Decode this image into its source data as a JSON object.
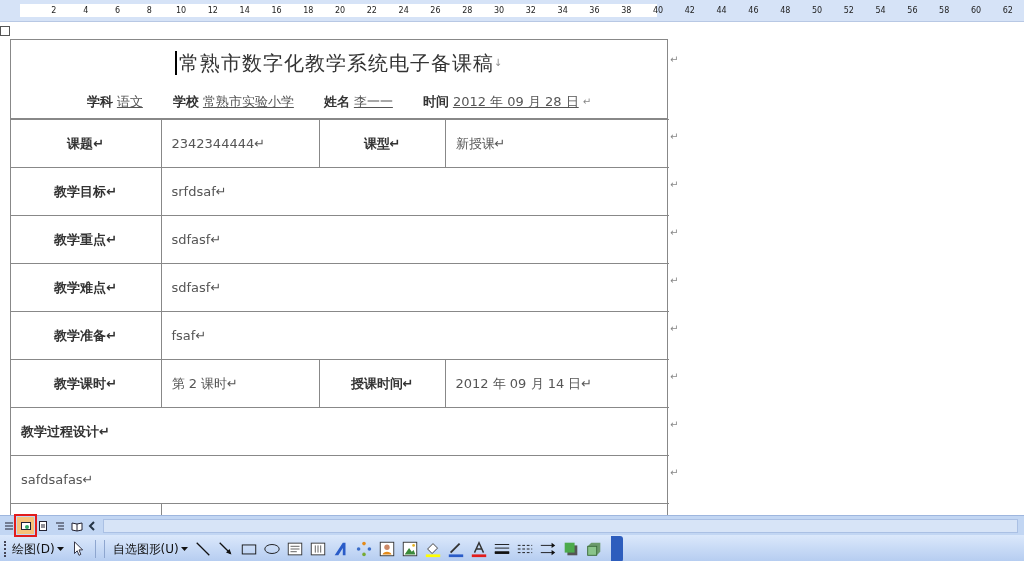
{
  "ruler": {
    "numbers": [
      "2",
      "4",
      "6",
      "8",
      "10",
      "12",
      "14",
      "16",
      "18",
      "20",
      "22",
      "24",
      "26",
      "28",
      "30",
      "32",
      "34",
      "36",
      "38",
      "40",
      "42",
      "44",
      "46",
      "48",
      "50",
      "52",
      "54",
      "56",
      "58",
      "60",
      "62"
    ]
  },
  "document": {
    "title": "常熟市数字化教学系统电子备课稿",
    "title_mark": "↓",
    "title_end_mark": "↵",
    "info": [
      {
        "label": "学科",
        "value": "语文"
      },
      {
        "label": "学校",
        "value": "常熟市实验小学"
      },
      {
        "label": "姓名",
        "value": "李一一"
      },
      {
        "label": "时间",
        "value": "2012 年 09 月 28 日"
      }
    ],
    "info_mark": "↵",
    "rows": [
      {
        "cells": [
          {
            "kind": "label",
            "text": "课题↵"
          },
          {
            "kind": "value",
            "text": "2342344444↵"
          },
          {
            "kind": "label",
            "text": "课型↵"
          },
          {
            "kind": "value",
            "text": "新授课↵"
          }
        ],
        "end_mark": "↵"
      },
      {
        "cells": [
          {
            "kind": "label",
            "text": "教学目标↵"
          },
          {
            "kind": "value",
            "text": "srfdsaf↵",
            "colspan": 3
          }
        ],
        "end_mark": "↵"
      },
      {
        "cells": [
          {
            "kind": "label",
            "text": "教学重点↵"
          },
          {
            "kind": "value",
            "text": "sdfasf↵",
            "colspan": 3
          }
        ],
        "end_mark": "↵"
      },
      {
        "cells": [
          {
            "kind": "label",
            "text": "教学难点↵"
          },
          {
            "kind": "value",
            "text": "sdfasf↵",
            "colspan": 3
          }
        ],
        "end_mark": "↵"
      },
      {
        "cells": [
          {
            "kind": "label",
            "text": "教学准备↵"
          },
          {
            "kind": "value",
            "text": "fsaf↵",
            "colspan": 3
          }
        ],
        "end_mark": "↵"
      },
      {
        "cells": [
          {
            "kind": "label",
            "text": "教学课时↵"
          },
          {
            "kind": "value",
            "text": "第 2 课时↵"
          },
          {
            "kind": "label",
            "text": "授课时间↵"
          },
          {
            "kind": "value",
            "text": "2012 年 09 月 14 日↵"
          }
        ],
        "end_mark": "↵"
      },
      {
        "cells": [
          {
            "kind": "heading",
            "text": "教学过程设计↵",
            "colspan": 4
          }
        ],
        "end_mark": "↵"
      },
      {
        "cells": [
          {
            "kind": "value",
            "text": "safdsafas↵",
            "colspan": 4
          }
        ],
        "end_mark": "↵"
      }
    ]
  },
  "view_buttons": [
    {
      "kind": "normal",
      "selected": false
    },
    {
      "kind": "web",
      "selected": true
    },
    {
      "kind": "print",
      "selected": false
    },
    {
      "kind": "outline",
      "selected": false
    },
    {
      "kind": "reading",
      "selected": false
    }
  ],
  "drawing_toolbar": {
    "items": [
      {
        "kind": "menu",
        "label": "绘图(D)"
      },
      {
        "kind": "pointer"
      },
      {
        "kind": "menu",
        "label": "自选图形(U)"
      },
      {
        "kind": "line"
      },
      {
        "kind": "arrow"
      },
      {
        "kind": "rect"
      },
      {
        "kind": "oval"
      },
      {
        "kind": "textbox"
      },
      {
        "kind": "vtextbox"
      },
      {
        "kind": "wordart"
      },
      {
        "kind": "diagram"
      },
      {
        "kind": "clipart"
      },
      {
        "kind": "picture"
      },
      {
        "kind": "fillcolor"
      },
      {
        "kind": "linecolor"
      },
      {
        "kind": "fontcolor"
      },
      {
        "kind": "linestyle"
      },
      {
        "kind": "dashstyle"
      },
      {
        "kind": "arrowstyle"
      },
      {
        "kind": "shadow"
      },
      {
        "kind": "threed"
      }
    ]
  }
}
